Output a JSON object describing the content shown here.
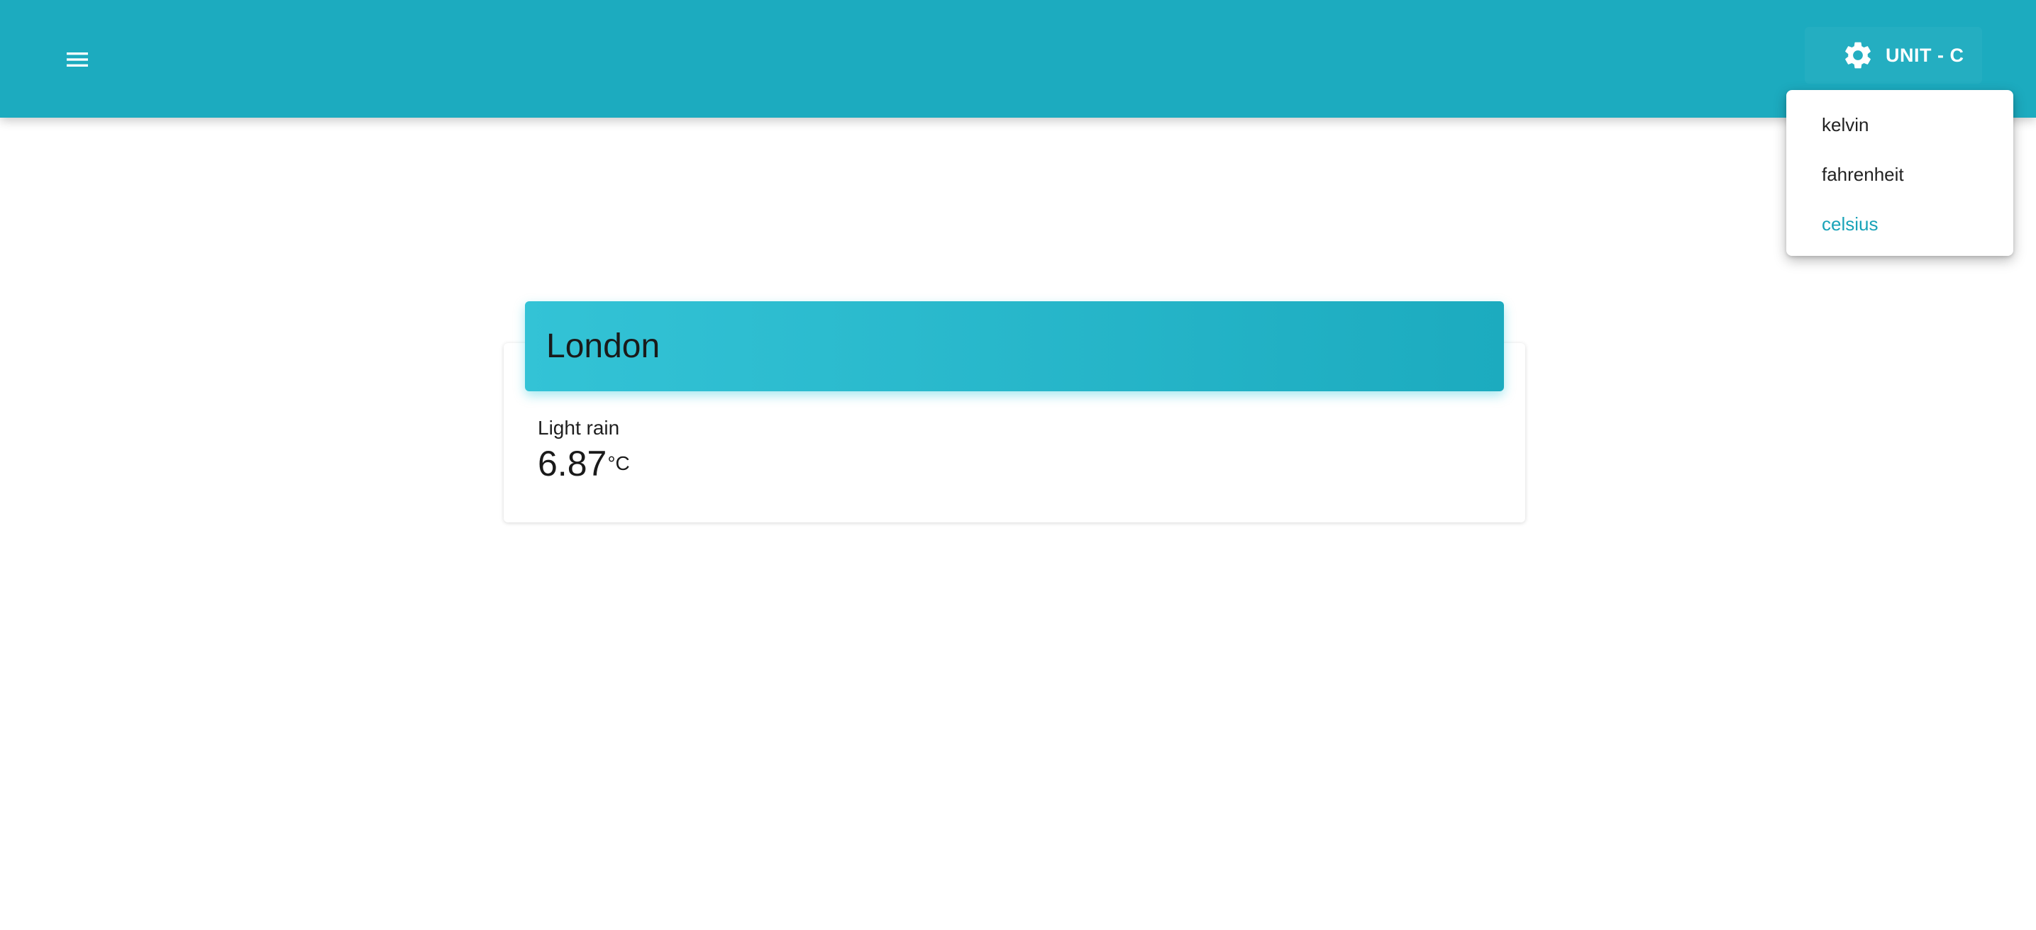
{
  "colors": {
    "appbar": "#1cabbf",
    "header_gradient_start": "#33c3d6",
    "header_gradient_end": "#1cabbf",
    "selected_option": "#1aa3b8"
  },
  "appbar": {
    "menu_icon": "hamburger-menu-icon",
    "settings_icon": "gear-icon",
    "unit_label": "UNIT - C"
  },
  "unit_menu": {
    "options": [
      {
        "label": "kelvin",
        "selected": false
      },
      {
        "label": "fahrenheit",
        "selected": false
      },
      {
        "label": "celsius",
        "selected": true
      }
    ]
  },
  "weather_card": {
    "city": "London",
    "condition": "Light rain",
    "temperature": "6.87",
    "unit_symbol": "°C"
  }
}
